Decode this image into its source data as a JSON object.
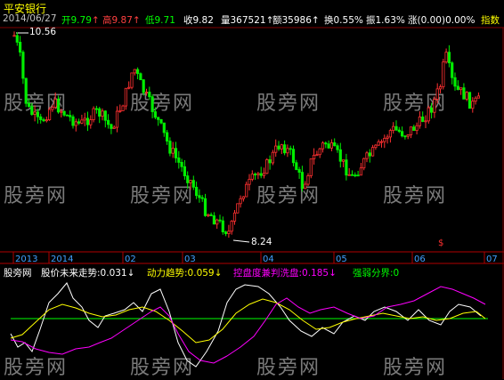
{
  "header": {
    "title": "平安银行",
    "date": "2014/06/27",
    "quotes": [
      {
        "label": "开",
        "value": "9.79",
        "color": "#00ff00",
        "arrow": "↑"
      },
      {
        "label": "高",
        "value": "9.87",
        "color": "#ff4040",
        "arrow": "↑"
      },
      {
        "label": "低",
        "value": "9.71",
        "color": "#00ff00",
        "arrow": ""
      },
      {
        "label": "收",
        "value": "9.82",
        "color": "#ffffff",
        "arrow": ""
      },
      {
        "label": "量",
        "value": "367521",
        "color": "#ffffff",
        "arrow": "↑"
      },
      {
        "label": "额",
        "value": "35986",
        "color": "#ffffff",
        "arrow": "↑"
      },
      {
        "label": "换",
        "value": "0.55%",
        "color": "#ffffff",
        "arrow": ""
      },
      {
        "label": "振",
        "value": "1.63%",
        "color": "#ffffff",
        "arrow": ""
      },
      {
        "label": "涨",
        "value": "(0.00)0.00%",
        "color": "#ffffff",
        "arrow": ""
      }
    ],
    "indicator_button": "指数"
  },
  "annotations": {
    "high_label": "10.56",
    "low_label": "8.24"
  },
  "x_axis": {
    "labels": [
      "2013",
      "2014",
      "02",
      "03",
      "04",
      "05",
      "06",
      "07"
    ],
    "marker": "$"
  },
  "watermark": "股旁网",
  "indicator": {
    "name": "股旁网",
    "lines": [
      {
        "label": "股价未来走势",
        "value": "0.031",
        "arrow": "↓",
        "color": "#ffffff"
      },
      {
        "label": "动力趋势",
        "value": "0.059",
        "arrow": "↓",
        "color": "#ffff00"
      },
      {
        "label": "控盘度兼判洗盘",
        "value": "0.185",
        "arrow": "↓",
        "color": "#ff00ff"
      },
      {
        "label": "强弱分界",
        "value": "0",
        "arrow": "",
        "color": "#00ff00"
      }
    ]
  },
  "colors": {
    "up": "#ff3030",
    "down": "#00ee00",
    "axis": "#b00000",
    "label_blue": "#40a0ff"
  }
}
